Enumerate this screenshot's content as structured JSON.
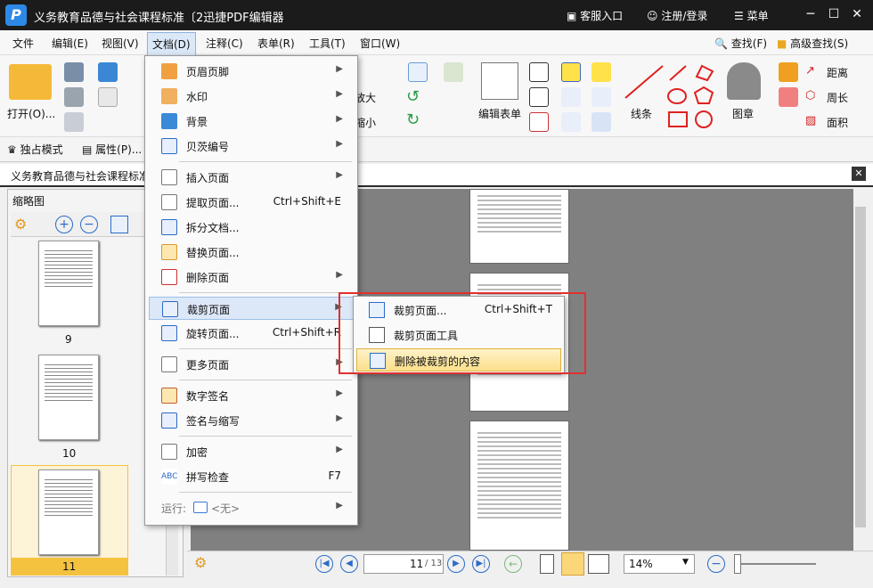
{
  "titlebar": {
    "title": "义务教育品德与社会课程标准〔2迅捷PDF编辑器",
    "service": "客服入口",
    "login": "注册/登录",
    "menu": "菜单",
    "minimize": "─",
    "maximize": "☐",
    "close": "✕"
  },
  "menubar": {
    "items": [
      "文件",
      "编辑(E)",
      "视图(V)",
      "文档(D)",
      "注释(C)",
      "表单(R)",
      "工具(T)",
      "窗口(W)"
    ],
    "find": "查找(F)",
    "advanced_find": "高级查找(S)"
  },
  "ribbon": {
    "open": "打开(O)...",
    "zoom_in": "放大",
    "zoom_out": "缩小",
    "edit_form": "编辑表单",
    "line": "线条",
    "stamp": "图章",
    "distance": "距离",
    "perimeter": "周长",
    "area": "面积"
  },
  "subbar": {
    "exclusive": "独占模式",
    "properties": "属性(P)..."
  },
  "tab": {
    "label": "义务教育品德与社会课程标准",
    "close": "✕"
  },
  "thumbnails": {
    "title": "缩略图",
    "pages": [
      "9",
      "10",
      "11"
    ]
  },
  "doc_menu": {
    "items": [
      {
        "label": "页眉页脚",
        "shortcut": "",
        "arrow": "▶"
      },
      {
        "label": "水印",
        "shortcut": "",
        "arrow": "▶"
      },
      {
        "label": "背景",
        "shortcut": "",
        "arrow": "▶"
      },
      {
        "label": "贝茨编号",
        "shortcut": "",
        "arrow": "▶"
      },
      {
        "label": "插入页面",
        "shortcut": "",
        "arrow": "▶"
      },
      {
        "label": "提取页面...",
        "shortcut": "Ctrl+Shift+E",
        "arrow": ""
      },
      {
        "label": "拆分文档...",
        "shortcut": "",
        "arrow": ""
      },
      {
        "label": "替换页面...",
        "shortcut": "",
        "arrow": ""
      },
      {
        "label": "删除页面",
        "shortcut": "",
        "arrow": "▶"
      },
      {
        "label": "裁剪页面",
        "shortcut": "",
        "arrow": "▶"
      },
      {
        "label": "旋转页面...",
        "shortcut": "Ctrl+Shift+R",
        "arrow": ""
      },
      {
        "label": "更多页面",
        "shortcut": "",
        "arrow": "▶"
      },
      {
        "label": "数字签名",
        "shortcut": "",
        "arrow": "▶"
      },
      {
        "label": "签名与缩写",
        "shortcut": "",
        "arrow": "▶"
      },
      {
        "label": "加密",
        "shortcut": "",
        "arrow": "▶"
      },
      {
        "label": "拼写检查",
        "shortcut": "F7",
        "arrow": ""
      },
      {
        "label": "运行:",
        "shortcut": "<无>",
        "arrow": "▶"
      }
    ]
  },
  "crop_submenu": {
    "items": [
      {
        "label": "裁剪页面...",
        "shortcut": "Ctrl+Shift+T"
      },
      {
        "label": "裁剪页面工具",
        "shortcut": ""
      },
      {
        "label": "删除被裁剪的内容",
        "shortcut": ""
      }
    ]
  },
  "statusbar": {
    "page_current": "11",
    "page_total": "/ 13",
    "zoom": "14%"
  },
  "colors": {
    "accent": "#2d89e6",
    "highlight_box": "#e03030",
    "menu_hover": "#fcdf8a"
  }
}
